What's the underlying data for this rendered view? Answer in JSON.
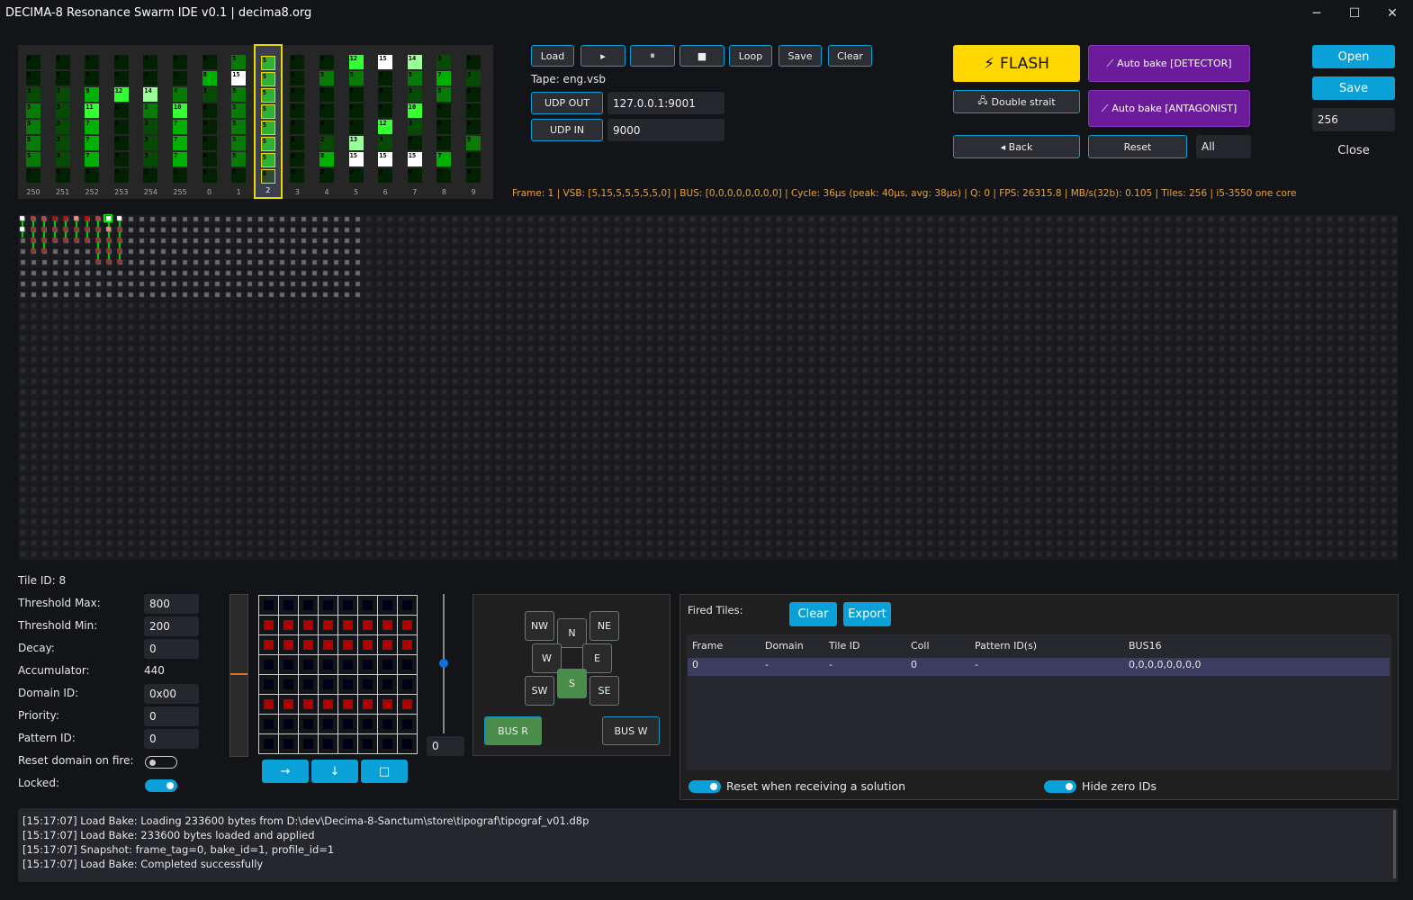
{
  "window": {
    "title": "DECIMA-8 Resonance Swarm IDE v0.1 | decima8.org",
    "minimize": "─",
    "maximize": "☐",
    "close": "✕"
  },
  "tile_strip": {
    "selected": "2",
    "columns": [
      {
        "id": "250",
        "values": [
          0,
          0,
          3,
          5,
          5,
          5,
          5,
          0
        ]
      },
      {
        "id": "251",
        "values": [
          0,
          0,
          3,
          3,
          3,
          3,
          3,
          0
        ]
      },
      {
        "id": "252",
        "values": [
          0,
          0,
          9,
          11,
          7,
          7,
          7,
          0
        ]
      },
      {
        "id": "253",
        "values": [
          0,
          0,
          12,
          0,
          0,
          0,
          0,
          0
        ]
      },
      {
        "id": "254",
        "values": [
          0,
          0,
          14,
          5,
          3,
          3,
          3,
          0
        ]
      },
      {
        "id": "255",
        "values": [
          0,
          0,
          4,
          10,
          7,
          7,
          7,
          0
        ]
      },
      {
        "id": "0",
        "values": [
          0,
          8,
          3,
          0,
          0,
          0,
          0,
          0
        ]
      },
      {
        "id": "1",
        "values": [
          5,
          15,
          5,
          5,
          5,
          5,
          5,
          0
        ]
      },
      {
        "id": "2",
        "values": [
          5,
          5,
          5,
          5,
          5,
          5,
          5,
          0
        ]
      },
      {
        "id": "3",
        "values": [
          0,
          0,
          0,
          0,
          0,
          0,
          0,
          0
        ]
      },
      {
        "id": "4",
        "values": [
          0,
          5,
          0,
          0,
          0,
          2,
          8,
          0
        ]
      },
      {
        "id": "5",
        "values": [
          12,
          5,
          0,
          0,
          0,
          13,
          15,
          0
        ]
      },
      {
        "id": "6",
        "values": [
          15,
          0,
          0,
          0,
          12,
          3,
          15,
          0
        ]
      },
      {
        "id": "7",
        "values": [
          14,
          5,
          3,
          10,
          3,
          0,
          15,
          0
        ]
      },
      {
        "id": "8",
        "values": [
          3,
          7,
          5,
          0,
          0,
          0,
          7,
          0
        ]
      },
      {
        "id": "9",
        "values": [
          0,
          3,
          0,
          0,
          0,
          5,
          0,
          0
        ]
      }
    ]
  },
  "tape": {
    "load": "Load",
    "play": "▸",
    "pause": "⏸",
    "stop": "■",
    "loop": "Loop",
    "save": "Save",
    "clear": "Clear",
    "label": "Tape: eng.vsb"
  },
  "udp": {
    "out_label": "UDP OUT",
    "out_value": "127.0.0.1:9001",
    "in_label": "UDP IN",
    "in_value": "9000"
  },
  "actions": {
    "flash": "FLASH",
    "flash_icon": "⚡",
    "double_strait": "Double strait",
    "double_icon": "🖧",
    "auto_detector": "Auto bake [DETECTOR]",
    "auto_antagonist": "Auto bake [ANTAGONIST]",
    "wand_icon": "⟋",
    "back": "◂ Back",
    "reset": "Reset",
    "filter": "All"
  },
  "file": {
    "open": "Open",
    "save": "Save",
    "size": "256",
    "close": "Close"
  },
  "status_line": "Frame: 1 | VSB: [5,15,5,5,5,5,5,0] | BUS: [0,0,0,0,0,0,0,0] | Cycle: 36µs (peak: 40µs, avg: 38µs) | Q: 0 | FPS: 26315.8 | MB/s(32b): 0.105 | Tiles: 256 | i5-3550 one core",
  "tile": {
    "id_label": "Tile ID: 8",
    "fields": [
      {
        "label": "Threshold Max:",
        "value": "800"
      },
      {
        "label": "Threshold Min:",
        "value": "200"
      },
      {
        "label": "Decay:",
        "value": "0"
      },
      {
        "label": "Accumulator:",
        "value": "440"
      },
      {
        "label": "Domain ID:",
        "value": "0x00"
      },
      {
        "label": "Priority:",
        "value": "0"
      },
      {
        "label": "Pattern ID:",
        "value": "0"
      }
    ],
    "reset_domain_label": "Reset domain on fire:",
    "reset_domain": false,
    "locked_label": "Locked:",
    "locked": true
  },
  "pattern": {
    "rows_on": [
      1,
      2,
      5
    ],
    "on_color": "#b00000",
    "off_color": "#000018",
    "btn_right": "→",
    "btn_down": "↓",
    "btn_square": "□",
    "slider_value": "0"
  },
  "directions": {
    "nw": "NW",
    "n": "N",
    "ne": "NE",
    "w": "W",
    "e": "E",
    "sw": "SW",
    "s": "S",
    "se": "SE",
    "active": "S",
    "bus_r": "BUS R",
    "bus_w": "BUS W",
    "bus_r_active": true
  },
  "fired": {
    "title": "Fired Tiles:",
    "clear": "Clear",
    "export": "Export",
    "columns": [
      "Frame",
      "Domain",
      "Tile ID",
      "Coll",
      "Pattern ID(s)",
      "BUS16"
    ],
    "rows": [
      [
        "0",
        "-",
        "-",
        "0",
        "-",
        "0,0,0,0,0,0,0,0"
      ]
    ],
    "reset_label": "Reset when receiving a solution",
    "reset_on": true,
    "hide_label": "Hide zero IDs",
    "hide_on": true
  },
  "log": [
    "[15:17:07] Load Bake: Loading 233600 bytes from D:\\dev\\Decima-8-Sanctum\\store\\tipograf\\tipograf_v01.d8p",
    "[15:17:07] Load Bake: 233600 bytes loaded and applied",
    "[15:17:07] Snapshot: frame_tag=0, bake_id=1, profile_id=1",
    "[15:17:07] Load Bake: Completed successfully"
  ]
}
